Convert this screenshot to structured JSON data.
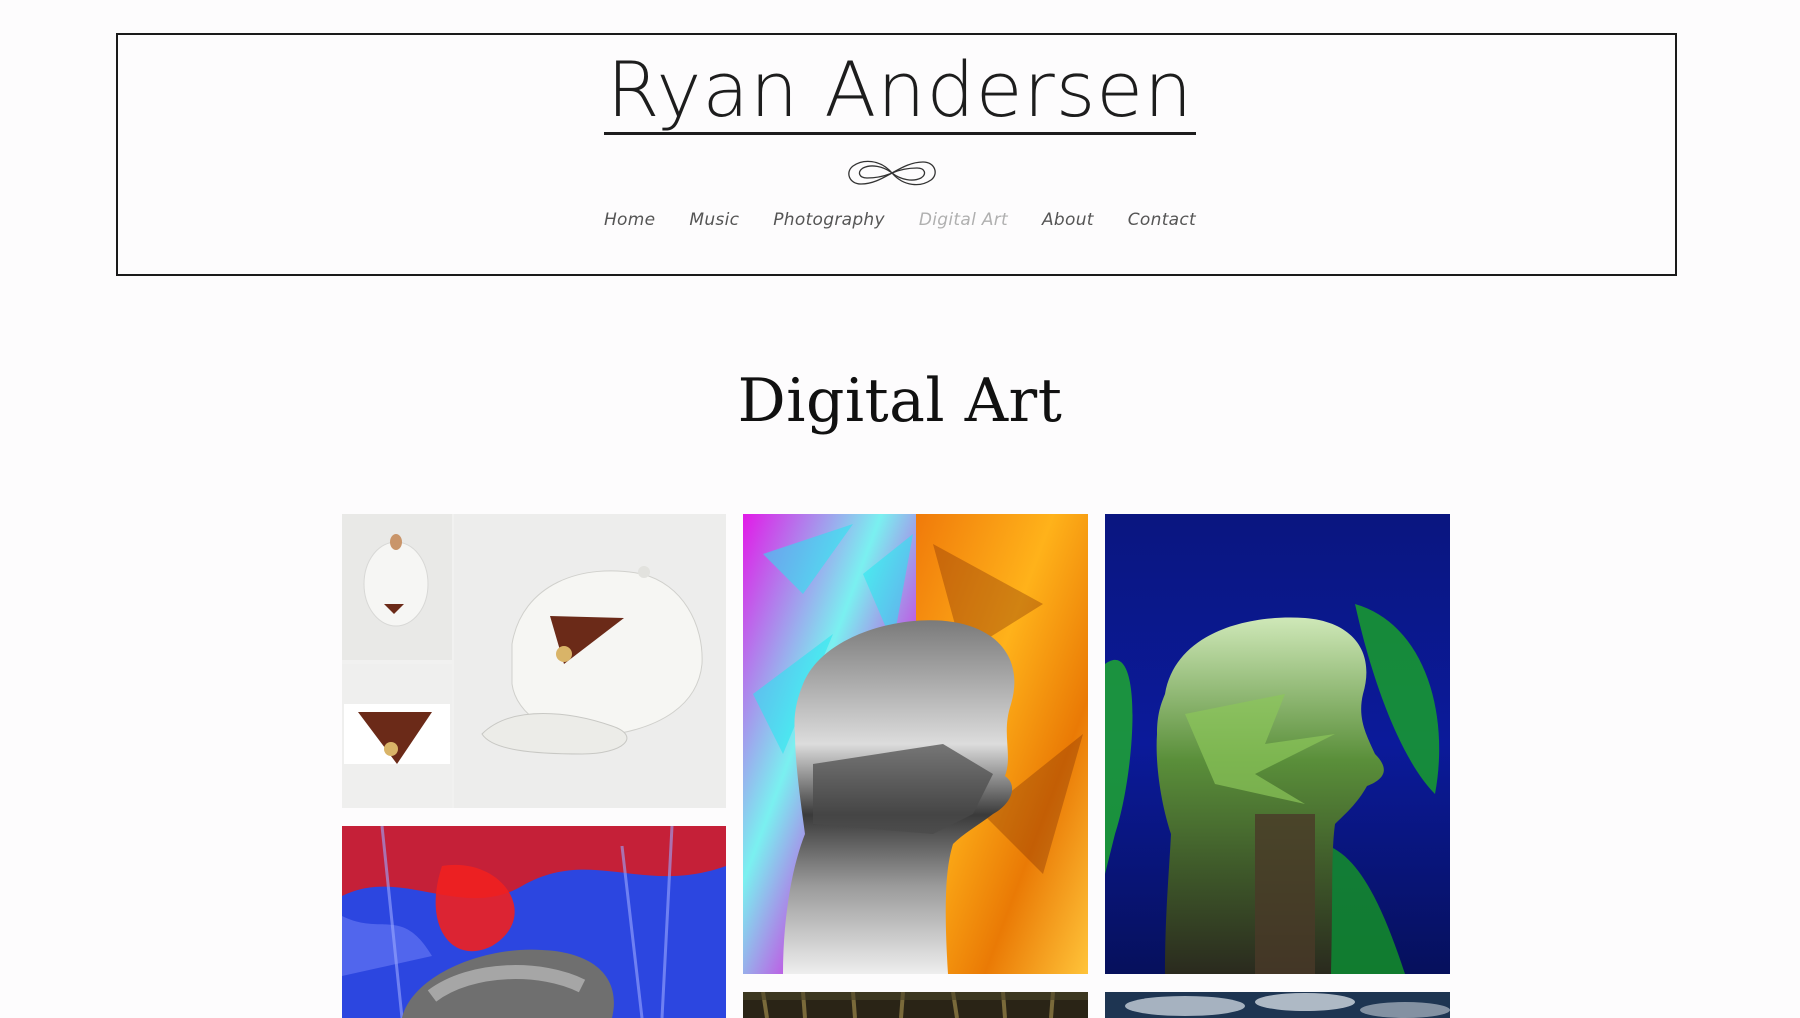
{
  "site": {
    "title": "Ryan Andersen"
  },
  "nav": {
    "items": [
      {
        "label": "Home",
        "active": false
      },
      {
        "label": "Music",
        "active": false
      },
      {
        "label": "Photography",
        "active": false
      },
      {
        "label": "Digital Art",
        "active": true
      },
      {
        "label": "About",
        "active": false
      },
      {
        "label": "Contact",
        "active": false
      }
    ]
  },
  "main": {
    "heading": "Digital Art"
  },
  "gallery": {
    "images": [
      {
        "name": "cap-triangle-logo"
      },
      {
        "name": "pink-orange-head-silhouette"
      },
      {
        "name": "forest-fern-head-silhouette"
      },
      {
        "name": "red-blue-forest-head"
      },
      {
        "name": "dark-forest-thumbnail"
      },
      {
        "name": "cloudy-sky-thumbnail"
      }
    ]
  },
  "colors": {
    "nav_text": "#555555",
    "nav_active": "#b0b0b0",
    "border": "#1a1a1a",
    "background": "#fdfcfd"
  }
}
